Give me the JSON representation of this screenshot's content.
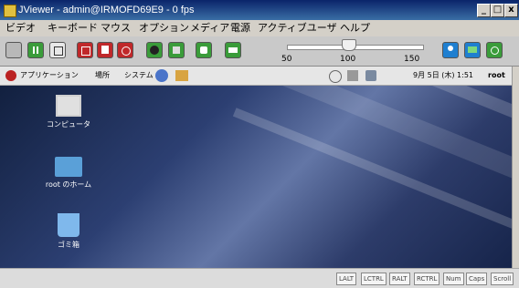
{
  "window": {
    "title": "JViewer - admin@IRMOFD69E9 - 0 fps",
    "min": "_",
    "max": "□",
    "close": "x"
  },
  "menu": [
    "ビデオ",
    "キーボード",
    "マウス",
    "オプション",
    "メディア",
    "電源",
    "アクティブユーザ",
    "ヘルプ"
  ],
  "slider": {
    "labels": [
      "50",
      "100",
      "150"
    ],
    "value": 100,
    "min": 50,
    "max": 150
  },
  "desktop_bar": {
    "items": [
      "アプリケーション",
      "場所",
      "システム"
    ],
    "datetime": "9月 5日 (木) 1:51",
    "user": "root"
  },
  "desktop_icons": [
    {
      "label": "コンピュータ",
      "icon": "computer-icon"
    },
    {
      "label": "root のホーム",
      "icon": "home-folder-icon"
    },
    {
      "label": "ゴミ箱",
      "icon": "trash-icon"
    }
  ],
  "status_keys": [
    "LALT",
    "LCTRL",
    "RALT",
    "RCTRL",
    "Num",
    "Caps",
    "Scroll"
  ],
  "colors": {
    "titlebar": "#0a246a",
    "desktop": "#2c3f72",
    "accent_green": "#3a9c3a",
    "accent_red": "#c0282a"
  }
}
